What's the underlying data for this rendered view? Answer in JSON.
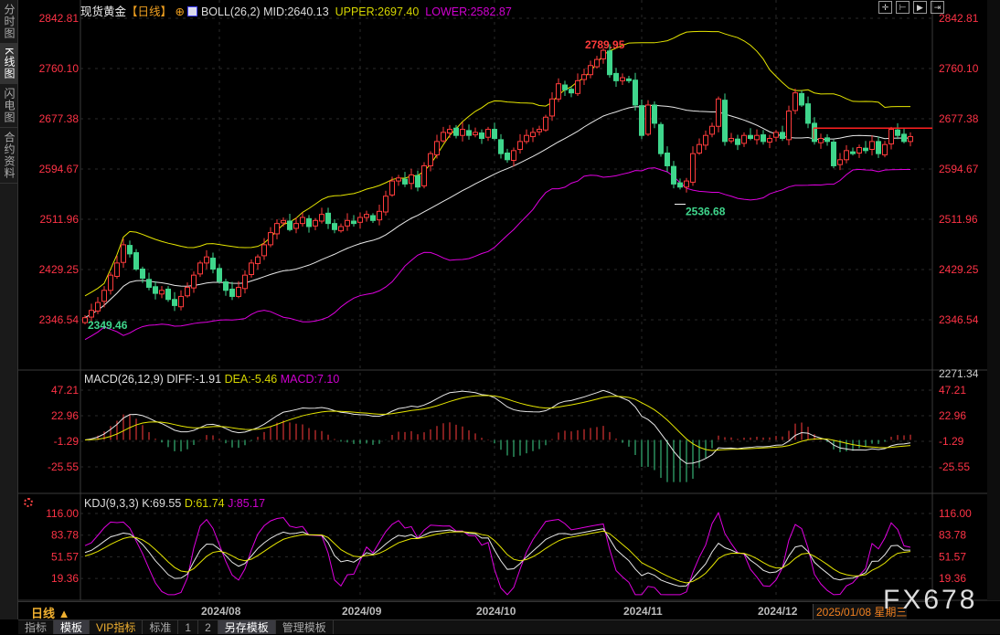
{
  "sidebar": {
    "tabs": [
      "分时图",
      "K线图",
      "闪电图",
      "合约资料"
    ]
  },
  "header": {
    "symbol": "现货黄金",
    "period": "【日线】",
    "boll_label": "BOLL(26,2)",
    "mid": "MID:2640.13",
    "upper": "UPPER:2697.40",
    "lower": "LOWER:2582.87"
  },
  "macd_header": {
    "label": "MACD(26,12,9)",
    "diff": "DIFF:-1.91",
    "dea": "DEA:-5.46",
    "macd": "MACD:7.10"
  },
  "kdj_header": {
    "label": "KDJ(9,3,3)",
    "k": "K:69.55",
    "d": "D:61.74",
    "j": "J:85.17"
  },
  "period_button": "日线 ▲",
  "toolbar_icons": [
    "crosshair-icon",
    "zoom-in-icon",
    "play-icon",
    "step-icon"
  ],
  "date_axis": [
    {
      "label": "2024/08",
      "idx": 21
    },
    {
      "label": "2024/09",
      "idx": 43
    },
    {
      "label": "2024/10",
      "idx": 64
    },
    {
      "label": "2024/11",
      "idx": 87
    },
    {
      "label": "2024/12",
      "idx": 108
    }
  ],
  "cursor_date": "2025/01/08 星期三",
  "bottom_tabs": [
    "指标",
    "模板",
    "VIP指标",
    "标准",
    "1",
    "2",
    "另存模板",
    "管理模板"
  ],
  "watermark": "FX678",
  "colors": {
    "up": "#ff3c3c",
    "down": "#3fd68c",
    "mid": "#e8e8e8",
    "upper": "#e6e600",
    "lower": "#e000e0",
    "axis": "#ff3346"
  },
  "chart_data": {
    "type": "candlestick",
    "price_ticks": [
      "2842.81",
      "2760.10",
      "2677.38",
      "2594.67",
      "2511.96",
      "2429.25",
      "2346.54"
    ],
    "price_bottom": "2271.34",
    "macd_ticks": [
      "47.21",
      "22.96",
      "-1.29",
      "-25.55"
    ],
    "kdj_ticks": [
      "116.00",
      "83.78",
      "51.57",
      "19.36"
    ],
    "annotations": {
      "high": "2789.95",
      "low": "2536.68",
      "start_low": "2349.46"
    },
    "resistance_line": 2662,
    "close": [
      2350,
      2362,
      2375,
      2395,
      2420,
      2440,
      2470,
      2455,
      2430,
      2415,
      2400,
      2390,
      2395,
      2380,
      2370,
      2385,
      2400,
      2420,
      2440,
      2450,
      2430,
      2410,
      2395,
      2385,
      2400,
      2420,
      2440,
      2450,
      2470,
      2490,
      2505,
      2510,
      2495,
      2505,
      2515,
      2500,
      2510,
      2520,
      2505,
      2495,
      2500,
      2510,
      2505,
      2515,
      2520,
      2510,
      2525,
      2550,
      2575,
      2580,
      2570,
      2585,
      2565,
      2600,
      2620,
      2640,
      2655,
      2660,
      2650,
      2660,
      2650,
      2655,
      2645,
      2660,
      2645,
      2620,
      2610,
      2625,
      2640,
      2650,
      2655,
      2660,
      2680,
      2710,
      2735,
      2725,
      2720,
      2740,
      2750,
      2765,
      2775,
      2790,
      2750,
      2740,
      2745,
      2740,
      2700,
      2650,
      2700,
      2670,
      2620,
      2600,
      2570,
      2565,
      2575,
      2620,
      2635,
      2650,
      2665,
      2710,
      2640,
      2645,
      2635,
      2650,
      2645,
      2650,
      2640,
      2645,
      2655,
      2645,
      2690,
      2720,
      2700,
      2670,
      2640,
      2645,
      2640,
      2600,
      2610,
      2625,
      2620,
      2630,
      2625,
      2640,
      2620,
      2635,
      2660,
      2650,
      2640,
      2648
    ]
  }
}
